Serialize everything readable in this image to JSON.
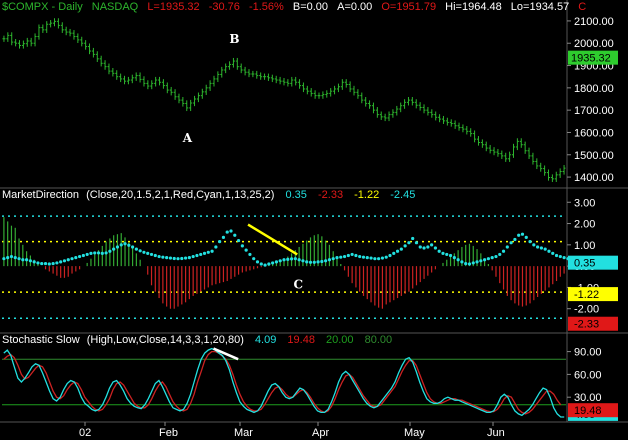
{
  "colors": {
    "bg": "#000000",
    "price": "#2db52d",
    "cyan": "#22e0e0",
    "red": "#cc2222",
    "green": "#33aa33",
    "yellow": "#ffff00",
    "white": "#ffffff",
    "grid": "#333333",
    "panel_sep": "#555555",
    "label_green": "#2ecc2e",
    "label_yellow": "#ffff00",
    "label_red": "#e01818",
    "overbought": "#2e8b2e",
    "oversold": "#1e9e1e"
  },
  "price_panel": {
    "symbol": "$COMPX",
    "interval": "Daily",
    "exchange": "NASDAQ",
    "last": "L=1935.32",
    "change": "-30.76",
    "change_pct": "-1.56%",
    "bid": "B=0.00",
    "ask": "A=0.00",
    "open": "O=1951.79",
    "high": "Hi=1964.48",
    "low": "Lo=1934.57",
    "extra": "C",
    "yaxis_labels": [
      "2100.00",
      "2000.00",
      "1900.00",
      "1800.00",
      "1700.00",
      "1600.00",
      "1500.00",
      "1400.00"
    ],
    "yaxis_values": [
      2100,
      2000,
      1900,
      1800,
      1700,
      1600,
      1500,
      1400
    ],
    "last_value": 1935.32,
    "last_label": "1935.32",
    "annotation_a": "A",
    "annotation_b": "B"
  },
  "market_direction": {
    "title": "MarketDirection",
    "params": "(Close,20,1.5,2,1,Red,Cyan,1,13,25,2)",
    "val1": "0.35",
    "val2": "-2.33",
    "val3": "-1.22",
    "val4": "-2.45",
    "yaxis_labels": [
      "3.00",
      "2.00",
      "1.00",
      "0.00",
      "-1.00",
      "-2.00"
    ],
    "yaxis_values": [
      3,
      2,
      1,
      0,
      -1,
      -2
    ],
    "upper_band": 2.35,
    "mid_band": 1.15,
    "lower_band": -1.22,
    "lower2_band": -2.45,
    "badge_cyan": "0.35",
    "badge_yellow": "-1.22",
    "badge_red": "-2.33",
    "annotation_c": "C"
  },
  "stochastic": {
    "title": "Stochastic Slow",
    "params": "(High,Low,Close,14,3,3,1,20,80)",
    "k_value": "4.09",
    "d_value": "19.48",
    "oversold_value": "20.00",
    "overbought_value": "80.00",
    "overbought": 80,
    "oversold": 20,
    "yaxis_labels": [
      "90.00",
      "60.00",
      "30.00"
    ],
    "yaxis_values": [
      90,
      60,
      30
    ],
    "badge_k": "4.09",
    "badge_d": "19.48"
  },
  "x_axis": {
    "labels": [
      "02",
      "Feb",
      "Mar",
      "Apr",
      "May",
      "Jun"
    ]
  },
  "chart_data": [
    {
      "type": "line",
      "title": "$COMPX - Daily NASDAQ",
      "series": [
        {
          "name": "",
          "values": [
            2020,
            2035,
            2005,
            2000,
            1990,
            1998,
            2010,
            2000,
            2030,
            2070,
            2060,
            2085,
            2090,
            2098,
            2080,
            2060,
            2050,
            2045,
            2030,
            2015,
            2000,
            1985,
            1965,
            1950,
            1930,
            1910,
            1895,
            1875,
            1865,
            1850,
            1840,
            1830,
            1835,
            1845,
            1855,
            1838,
            1820,
            1808,
            1820,
            1835,
            1825,
            1810,
            1790,
            1780,
            1760,
            1745,
            1730,
            1710,
            1732,
            1750,
            1765,
            1782,
            1800,
            1820,
            1840,
            1860,
            1880,
            1895,
            1905,
            1920,
            1895,
            1880,
            1870,
            1862,
            1862,
            1855,
            1850,
            1850,
            1845,
            1840,
            1835,
            1830,
            1825,
            1820,
            1835,
            1825,
            1810,
            1795,
            1785,
            1775,
            1765,
            1765,
            1770,
            1775,
            1785,
            1795,
            1805,
            1825,
            1815,
            1795,
            1780,
            1765,
            1745,
            1730,
            1720,
            1700,
            1680,
            1670,
            1665,
            1680,
            1690,
            1705,
            1720,
            1735,
            1745,
            1735,
            1722,
            1712,
            1700,
            1690,
            1680,
            1668,
            1660,
            1652,
            1645,
            1640,
            1630,
            1622,
            1615,
            1605,
            1595,
            1570,
            1555,
            1545,
            1530,
            1520,
            1512,
            1505,
            1495,
            1482,
            1500,
            1535,
            1560,
            1545,
            1518,
            1495,
            1470,
            1450,
            1438,
            1420,
            1398,
            1392,
            1410,
            1425,
            1440
          ]
        }
      ],
      "ylim": [
        1360,
        2140
      ]
    },
    {
      "type": "bar",
      "title": "MarketDirection",
      "series": [
        {
          "name": "",
          "values": [
            2.3,
            2.1,
            1.9,
            1.8,
            1.3,
            1.0,
            0.7,
            0.5,
            0.3,
            0.15,
            0.0,
            -0.15,
            -0.25,
            -0.35,
            -0.45,
            -0.55,
            -0.55,
            -0.5,
            -0.35,
            -0.25,
            -0.15,
            0.0,
            0.15,
            0.35,
            0.55,
            0.75,
            0.95,
            1.15,
            1.3,
            1.45,
            1.5,
            1.55,
            1.35,
            1.1,
            0.9,
            0.6,
            0.3,
            0.0,
            -0.4,
            -0.9,
            -1.2,
            -1.5,
            -1.75,
            -1.9,
            -2.0,
            -2.0,
            -1.9,
            -1.8,
            -1.7,
            -1.55,
            -1.4,
            -1.3,
            -1.2,
            -1.1,
            -1.0,
            -0.9,
            -0.85,
            -0.8,
            -0.75,
            -0.7,
            -0.6,
            -0.5,
            -0.4,
            -0.3,
            -0.25,
            -0.2,
            -0.15,
            -0.1,
            -0.05,
            0.0,
            0.05,
            0.1,
            0.15,
            0.25,
            0.35,
            0.45,
            0.6,
            0.75,
            0.9,
            1.05,
            1.2,
            1.35,
            1.45,
            1.5,
            1.4,
            1.2,
            1.0,
            0.7,
            0.4,
            0.1,
            -0.2,
            -0.5,
            -0.8,
            -1.0,
            -1.2,
            -1.4,
            -1.55,
            -1.7,
            -1.85,
            -1.95,
            -2.0,
            -1.8,
            -1.7,
            -1.6,
            -1.5,
            -1.4,
            -1.3,
            -1.2,
            -1.05,
            -0.9,
            -0.75,
            -0.6,
            -0.45,
            -0.3,
            -0.15,
            0.0,
            0.15,
            0.3,
            0.45,
            0.6,
            0.75,
            0.9,
            1.0,
            1.05,
            0.95,
            0.8,
            0.6,
            0.35,
            0.1,
            -0.2,
            -0.5,
            -0.8,
            -1.1,
            -1.4,
            -1.6,
            -1.75,
            -1.85,
            -1.9,
            -1.85,
            -1.75,
            -1.6,
            -1.45,
            -1.3,
            -1.15,
            -1.0,
            -0.85,
            -0.7,
            -0.5,
            -0.35
          ]
        },
        {
          "name": "",
          "values": [
            0.35,
            0.4,
            0.45,
            0.4,
            0.35,
            0.3,
            0.3,
            0.25,
            0.2,
            0.15,
            0.12,
            0.12,
            0.1,
            0.12,
            0.15,
            0.2,
            0.25,
            0.3,
            0.35,
            0.4,
            0.45,
            0.5,
            0.55,
            0.6,
            0.62,
            0.62,
            0.6,
            0.62,
            0.7,
            0.8,
            0.9,
            1.0,
            1.05,
            0.98,
            0.9,
            0.8,
            0.72,
            0.65,
            0.6,
            0.55,
            0.5,
            0.45,
            0.42,
            0.4,
            0.38,
            0.36,
            0.35,
            0.36,
            0.38,
            0.4,
            0.45,
            0.5,
            0.55,
            0.6,
            0.65,
            0.7,
            0.9,
            1.15,
            1.35,
            1.6,
            1.65,
            1.45,
            1.2,
            0.95,
            0.75,
            0.55,
            0.35,
            0.2,
            0.1,
            0.05,
            0.1,
            0.15,
            0.2,
            0.25,
            0.3,
            0.32,
            0.34,
            0.35,
            0.3,
            0.25,
            0.2,
            0.18,
            0.18,
            0.2,
            0.22,
            0.25,
            0.3,
            0.35,
            0.4,
            0.42,
            0.45,
            0.5,
            0.55,
            0.5,
            0.45,
            0.42,
            0.4,
            0.38,
            0.35,
            0.35,
            0.38,
            0.42,
            0.5,
            0.6,
            0.7,
            0.8,
            0.95,
            1.1,
            1.3,
            1.1,
            0.9,
            0.85,
            0.9,
            1.0,
            0.85,
            0.7,
            0.6,
            0.55,
            0.5,
            0.4,
            0.3,
            0.2,
            0.12,
            0.1,
            0.15,
            0.2,
            0.25,
            0.3,
            0.35,
            0.4,
            0.45,
            0.55,
            0.7,
            0.9,
            1.1,
            1.25,
            1.45,
            1.5,
            1.35,
            1.15,
            1.0,
            0.9,
            0.85,
            0.8,
            0.7,
            0.6,
            0.5,
            0.45,
            0.4,
            0.35,
            0.35
          ]
        }
      ],
      "ylim": [
        -3.0,
        3.2
      ]
    },
    {
      "type": "line",
      "title": "Stochastic Slow",
      "series": [
        {
          "name": "",
          "values": [
            88,
            92,
            85,
            70,
            55,
            50,
            55,
            62,
            70,
            74,
            72,
            62,
            50,
            38,
            28,
            25,
            30,
            40,
            48,
            52,
            50,
            42,
            30,
            22,
            18,
            14,
            12,
            14,
            20,
            30,
            42,
            50,
            52,
            46,
            38,
            28,
            22,
            18,
            16,
            15,
            20,
            28,
            38,
            48,
            52,
            44,
            34,
            24,
            16,
            14,
            12,
            14,
            22,
            34,
            50,
            66,
            80,
            88,
            92,
            94,
            92,
            88,
            85,
            78,
            66,
            50,
            36,
            24,
            18,
            14,
            12,
            10,
            12,
            18,
            28,
            38,
            46,
            48,
            44,
            36,
            30,
            28,
            30,
            36,
            42,
            40,
            34,
            26,
            18,
            12,
            10,
            10,
            14,
            24,
            36,
            50,
            60,
            64,
            60,
            52,
            44,
            36,
            28,
            22,
            18,
            16,
            18,
            24,
            30,
            36,
            42,
            50,
            62,
            72,
            80,
            82,
            76,
            64,
            50,
            38,
            28,
            24,
            22,
            22,
            24,
            28,
            30,
            28,
            26,
            26,
            24,
            22,
            20,
            18,
            16,
            14,
            12,
            10,
            10,
            12,
            20,
            30,
            34,
            30,
            20,
            12,
            8,
            6,
            10,
            14,
            20,
            28,
            36,
            42,
            40,
            30,
            16,
            8,
            4,
            4
          ]
        },
        {
          "name": "",
          "values": [
            80,
            84,
            86,
            82,
            72,
            60,
            54,
            56,
            62,
            68,
            72,
            70,
            62,
            50,
            38,
            30,
            28,
            32,
            40,
            46,
            50,
            48,
            40,
            30,
            24,
            18,
            14,
            12,
            14,
            20,
            28,
            40,
            48,
            50,
            46,
            38,
            30,
            22,
            18,
            16,
            16,
            20,
            28,
            38,
            46,
            50,
            44,
            34,
            24,
            18,
            14,
            12,
            14,
            22,
            34,
            50,
            64,
            78,
            86,
            90,
            90,
            88,
            84,
            80,
            72,
            60,
            46,
            34,
            24,
            18,
            14,
            12,
            12,
            14,
            20,
            28,
            36,
            42,
            44,
            40,
            34,
            30,
            30,
            34,
            38,
            40,
            36,
            30,
            22,
            16,
            12,
            10,
            12,
            18,
            28,
            40,
            50,
            58,
            60,
            56,
            48,
            40,
            32,
            26,
            20,
            18,
            18,
            20,
            26,
            32,
            38,
            44,
            54,
            64,
            72,
            78,
            78,
            72,
            60,
            48,
            36,
            28,
            24,
            22,
            22,
            24,
            26,
            28,
            28,
            26,
            26,
            24,
            22,
            20,
            18,
            16,
            14,
            12,
            11,
            11,
            14,
            20,
            28,
            32,
            30,
            22,
            14,
            10,
            8,
            10,
            14,
            20,
            26,
            32,
            38,
            38,
            34,
            26,
            20
          ]
        }
      ],
      "ylim": [
        0,
        100
      ]
    }
  ]
}
